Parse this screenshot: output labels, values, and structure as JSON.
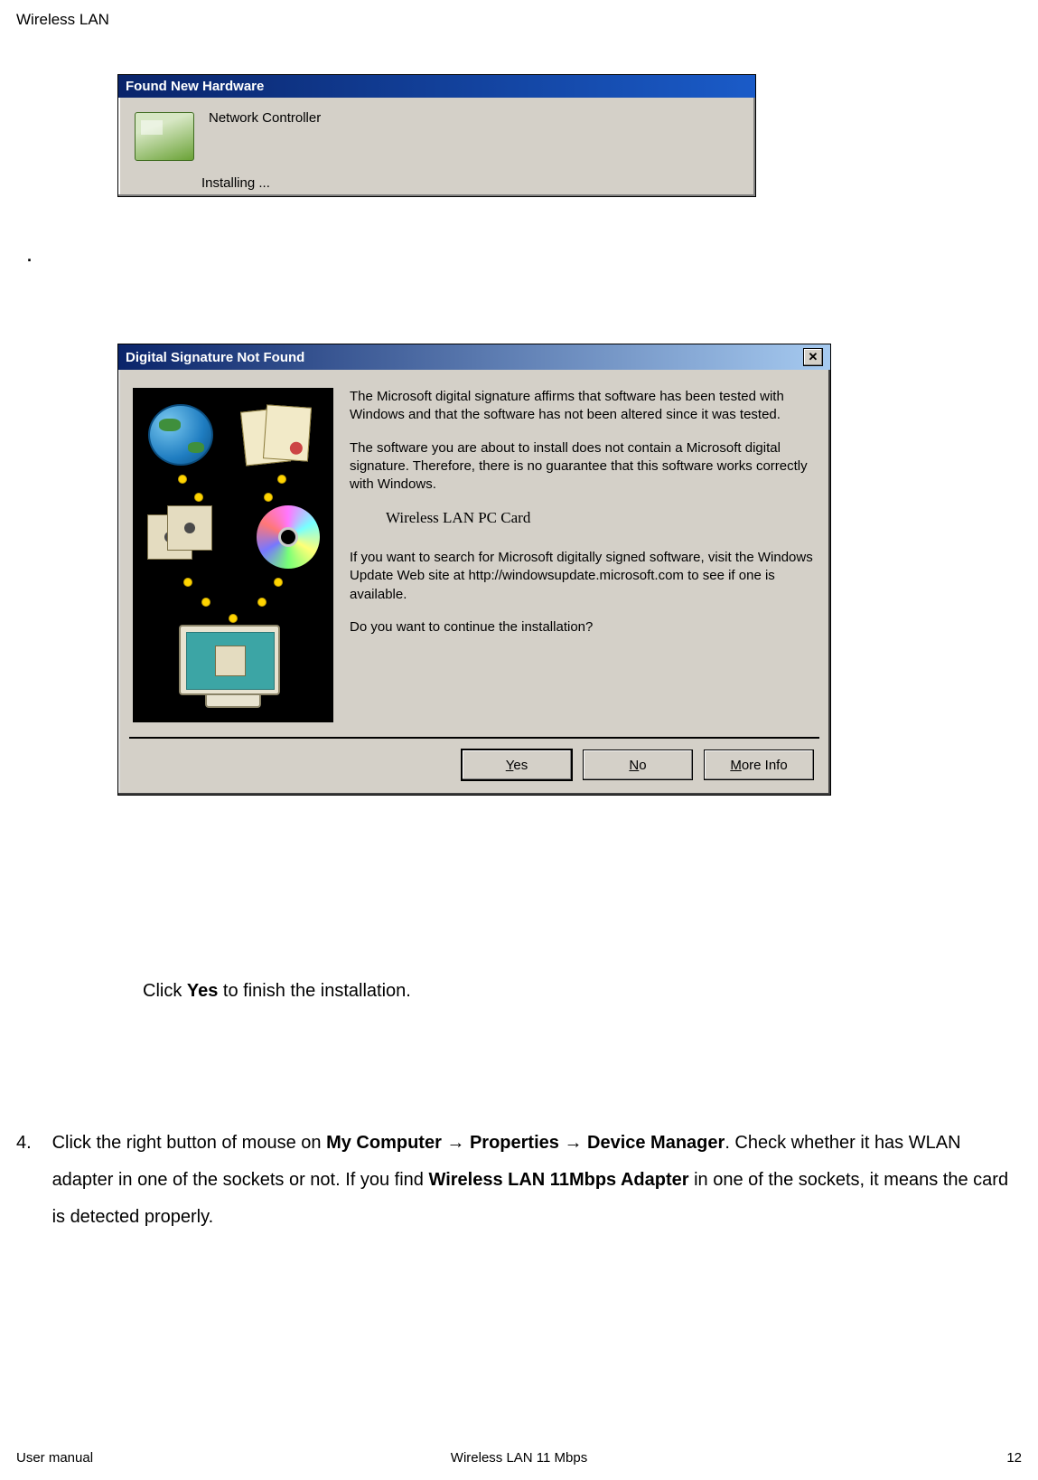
{
  "page_header": "Wireless LAN",
  "dot": ".",
  "dialog1": {
    "title": "Found New Hardware",
    "line1": "Network Controller",
    "status": "Installing ..."
  },
  "dialog2": {
    "title": "Digital Signature Not Found",
    "close": "✕",
    "p1": "The Microsoft digital signature affirms that software has been tested with Windows and that the software has not been altered since it was tested.",
    "p2": "The software you are about to install does not contain a Microsoft digital signature. Therefore, there is no guarantee that this software works correctly with Windows.",
    "device": "Wireless LAN PC Card",
    "p3": "If you want to search for Microsoft digitally signed software, visit the Windows Update Web site at http://windowsupdate.microsoft.com to see if one is available.",
    "p4": "Do you want to continue the installation?",
    "yes_u": "Y",
    "yes_rest": "es",
    "no_u": "N",
    "no_rest": "o",
    "more_u": "M",
    "more_rest": "ore Info"
  },
  "instruction1_pre": "Click ",
  "instruction1_bold": "Yes",
  "instruction1_post": " to finish the installation.",
  "step4": {
    "num": "4.",
    "t1": "Click the right button of mouse on ",
    "b1": "My Computer ",
    "arrow": "→",
    "b2": " Properties ",
    "b3": " Device Manager",
    "t2": ". Check whether it has WLAN adapter in one of the sockets or not.  If you find ",
    "b4": "Wireless LAN 11Mbps Adapter",
    "t3": " in one of the sockets, it means the card is detected properly."
  },
  "footer": {
    "left": "User manual",
    "center": "Wireless LAN 11 Mbps",
    "right": "12"
  }
}
